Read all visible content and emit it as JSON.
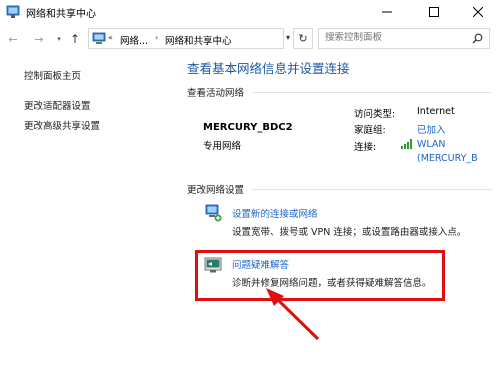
{
  "window": {
    "title": "网络和共享中心",
    "min_icon": "minimize-icon",
    "max_icon": "maximize-icon",
    "close_icon": "close-icon"
  },
  "address": {
    "prefix": "«",
    "crumbs": [
      "网络...",
      "网络和共享中心"
    ],
    "search_placeholder": "搜索控制面板"
  },
  "sidebar": {
    "items": [
      {
        "label": "控制面板主页"
      },
      {
        "label": "更改适配器设置"
      },
      {
        "label": "更改高级共享设置"
      }
    ]
  },
  "main": {
    "title": "查看基本网络信息并设置连接",
    "active_section": "查看活动网络",
    "network": {
      "name": "MERCURY_BDC2",
      "type": "专用网络",
      "access_label": "访问类型:",
      "access_value": "Internet",
      "homegroup_label": "家庭组:",
      "homegroup_value": "已加入",
      "connections_label": "连接:",
      "connections_value_1": "WLAN",
      "connections_value_2": "(MERCURY_B"
    },
    "change_section": "更改网络设置",
    "tasks": [
      {
        "title": "设置新的连接或网络",
        "desc": "设置宽带、拨号或 VPN 连接；或设置路由器或接入点。"
      },
      {
        "title": "问题疑难解答",
        "desc": "诊断并修复网络问题，或者获得疑难解答信息。"
      }
    ]
  },
  "colors": {
    "link": "#1e64c8",
    "title_blue": "#1e5aa0",
    "highlight": "#e01010"
  }
}
